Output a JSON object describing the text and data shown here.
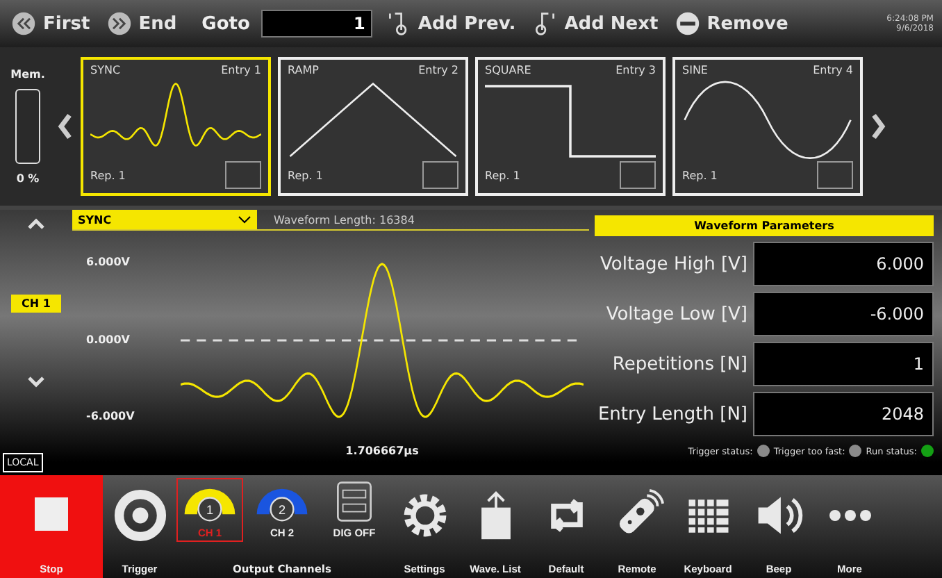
{
  "toolbar": {
    "first": "First",
    "end": "End",
    "goto_label": "Goto",
    "goto_value": "1",
    "add_prev": "Add Prev.",
    "add_next": "Add Next",
    "remove": "Remove",
    "time": "6:24:08 PM",
    "date": "9/6/2018"
  },
  "memory": {
    "label": "Mem.",
    "level": 0,
    "reading": "0 %"
  },
  "entries": [
    {
      "kind": "sync",
      "name": "SYNC",
      "entry": "Entry 1",
      "rep": "Rep. 1",
      "selected": true
    },
    {
      "kind": "ramp",
      "name": "RAMP",
      "entry": "Entry 2",
      "rep": "Rep. 1",
      "selected": false
    },
    {
      "kind": "square",
      "name": "SQUARE",
      "entry": "Entry 3",
      "rep": "Rep. 1",
      "selected": false
    },
    {
      "kind": "sine",
      "name": "SINE",
      "entry": "Entry 4",
      "rep": "Rep. 1",
      "selected": false
    }
  ],
  "waveform": {
    "selector": "SYNC",
    "length": "Waveform Length:  16384",
    "channel": "CH 1",
    "y_high": "6.000V",
    "y_zero": "0.000V",
    "y_low": "-6.000V",
    "time_span": "1.706667µs",
    "mode": "LOCAL"
  },
  "parameters": {
    "title": "Waveform Parameters",
    "fields": [
      {
        "label": "Voltage High [V]",
        "value": "6.000"
      },
      {
        "label": "Voltage Low [V]",
        "value": "-6.000"
      },
      {
        "label": "Repetitions [N]",
        "value": "1"
      },
      {
        "label": "Entry Length [N]",
        "value": "2048"
      }
    ]
  },
  "status": [
    {
      "label": "Trigger status:",
      "color": "#8a8a8a"
    },
    {
      "label": "Trigger too fast:",
      "color": "#8a8a8a"
    },
    {
      "label": "Run status:",
      "color": "#14a014"
    }
  ],
  "bottom": {
    "stop": "Stop",
    "trigger": "Trigger",
    "group": "Output Channels",
    "channels": [
      {
        "kind": "ch",
        "number": "1",
        "label": "CH 1",
        "color": "#f5e600",
        "selected": true
      },
      {
        "kind": "ch",
        "number": "2",
        "label": "CH 2",
        "color": "#1a55e0",
        "selected": false
      },
      {
        "kind": "dig",
        "label": "DIG OFF",
        "selected": false
      }
    ],
    "tools": [
      {
        "kind": "settings",
        "label": "Settings"
      },
      {
        "kind": "list",
        "label": "Wave. List"
      },
      {
        "kind": "default",
        "label": "Default"
      },
      {
        "kind": "remote",
        "label": "Remote"
      },
      {
        "kind": "keyboard",
        "label": "Keyboard"
      },
      {
        "kind": "beep",
        "label": "Beep"
      },
      {
        "kind": "more",
        "label": "More"
      }
    ]
  }
}
